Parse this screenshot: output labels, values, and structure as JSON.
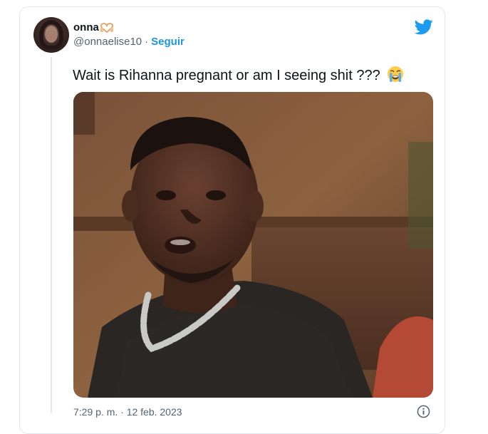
{
  "tweet": {
    "display_name": "onna",
    "handle": "@onnaelise10",
    "separator": "·",
    "follow_label": "Seguir",
    "text": "Wait is Rihanna pregnant or am I seeing shit ???",
    "timestamp": "7:29 p. m. · 12 feb. 2023"
  },
  "icons": {
    "name_emoji": "heart-hands-icon",
    "text_emoji": "loudly-crying-face-icon",
    "brand": "twitter-bird-icon",
    "info": "info-icon"
  },
  "colors": {
    "twitter_blue": "#1d9bf0",
    "follow_link": "#1b95e0",
    "text_primary": "#0f1419",
    "text_secondary": "#536471",
    "border": "#e1e8ed"
  }
}
